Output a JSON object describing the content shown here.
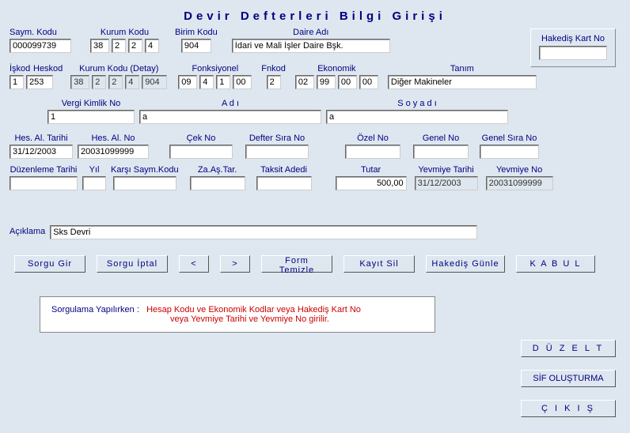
{
  "title": "Devir Defterleri Bilgi Girişi",
  "labels": {
    "sayim_kodu": "Saym. Kodu",
    "kurum_kodu": "Kurum Kodu",
    "birim_kodu": "Birim Kodu",
    "daire_adi": "Daire Adı",
    "hakedis_kart_no": "Hakediş Kart No",
    "iskod": "İşkod",
    "heskod": "Heskod",
    "kurum_kodu_detay": "Kurum Kodu (Detay)",
    "fonksiyonel": "Fonksiyonel",
    "fnkod": "Fnkod",
    "ekonomik": "Ekonomik",
    "tanim": "Tanım",
    "vergi_kimlik_no": "Vergi Kimlik No",
    "adi": "A d ı",
    "soyadi": "S o y a d ı",
    "hes_al_tarihi": "Hes. Al. Tarihi",
    "hes_al_no": "Hes. Al. No",
    "cek_no": "Çek No",
    "defter_sira_no": "Defter Sıra No",
    "ozel_no": "Özel No",
    "genel_no": "Genel No",
    "genel_sira_no": "Genel Sıra No",
    "duzenleme_tarihi": "Düzenleme Tarihi",
    "yil": "Yıl",
    "karsi_sayim_kodu": "Karşı Saym.Kodu",
    "za_as_tar": "Za.Aş.Tar.",
    "taksit_adedi": "Taksit Adedi",
    "tutar": "Tutar",
    "yevmiye_tarihi": "Yevmiye Tarihi",
    "yevmiye_no": "Yevmiye No",
    "aciklama": "Açıklama"
  },
  "values": {
    "sayim_kodu": "000099739",
    "kurum1": "38",
    "kurum2": "2",
    "kurum3": "2",
    "kurum4": "4",
    "birim_kodu": "904",
    "daire_adi": "İdari ve Mali İşler Daire Bşk.",
    "hakedis": "",
    "iskod": "1",
    "heskod": "253",
    "kd1": "38",
    "kd2": "2",
    "kd3": "2",
    "kd4": "4",
    "kd5": "904",
    "fk1": "09",
    "fk2": "4",
    "fk3": "1",
    "fk4": "00",
    "fnkod": "2",
    "ek1": "02",
    "ek2": "99",
    "ek3": "00",
    "ek4": "00",
    "tanim": "Diğer Makineler",
    "vergi": "1",
    "adi": "a",
    "soyadi": "a",
    "hes_tar": "31/12/2003",
    "hes_no": "20031099999",
    "cek": "",
    "defter": "",
    "ozel": "",
    "genel": "",
    "gsira": "",
    "duz": "",
    "yil": "",
    "karsi": "",
    "zaas": "",
    "taksit": "",
    "tutar": "500,00",
    "yev_tar": "31/12/2003",
    "yev_no": "20031099999",
    "aciklama": "Sks Devri"
  },
  "buttons": {
    "sorgu_gir": "Sorgu Gir",
    "sorgu_iptal": "Sorgu İptal",
    "prev": "<",
    "next": ">",
    "form_temizle": "Form Temizle",
    "kayit_sil": "Kayıt Sil",
    "hakedis_gunle": "Hakediş Günle",
    "kabul": "K A B U L",
    "duzelt": "D Ü Z E L T",
    "sif": "SİF OLUŞTURMA",
    "cikis": "Ç I K I Ş"
  },
  "help": {
    "prefix": "Sorgulama Yapılırken :",
    "line1": "Hesap Kodu ve Ekonomik Kodlar  veya   Hakediş Kart No",
    "line2": "veya   Yevmiye Tarihi ve Yevmiye No  girilir."
  }
}
